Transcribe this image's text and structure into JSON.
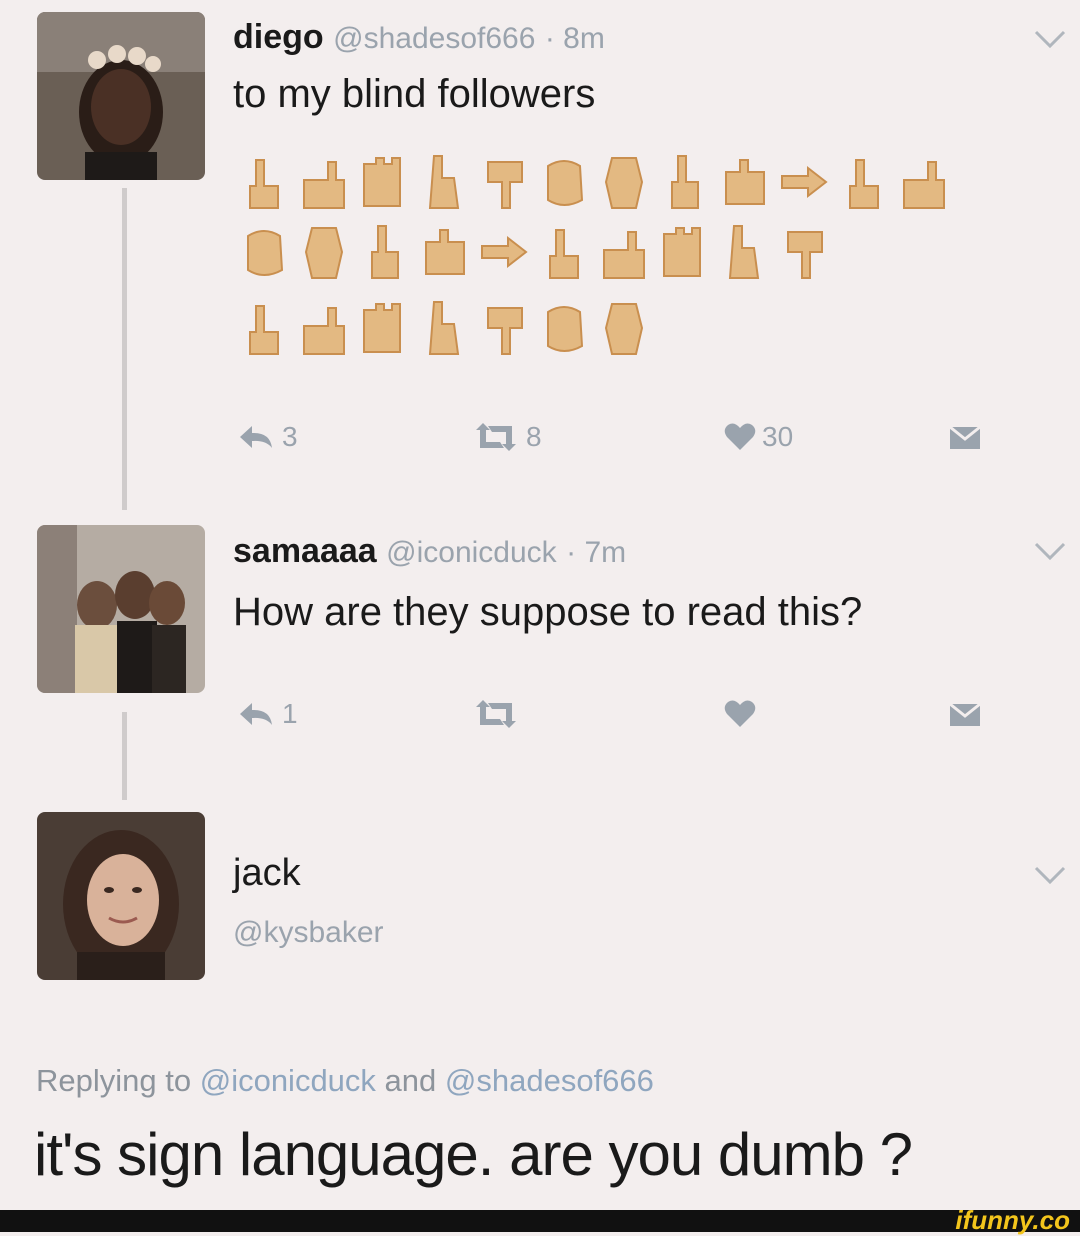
{
  "tweets": [
    {
      "name": "diego",
      "handle": "@shadesof666",
      "time": "· 8m",
      "text": "to my blind followers",
      "reply_count": "3",
      "retweet_count": "8",
      "like_count": "30"
    },
    {
      "name": "samaaaa",
      "handle": "@iconicduck",
      "time": "· 7m",
      "text": "How are they suppose to read this?",
      "reply_count": "1",
      "retweet_count": "",
      "like_count": ""
    },
    {
      "name": "jack",
      "handle": "@kysbaker",
      "replying_prefix": "Replying to ",
      "replying_mention_1": "@iconicduck",
      "replying_and": " and ",
      "replying_mention_2": "@shadesof666",
      "text": "it's sign language. are you dumb ?"
    }
  ],
  "emoji_icons": [
    "hand-gesture-icon"
  ],
  "watermark": "ifunny.co",
  "colors": {
    "background": "#f3eeee",
    "muted": "#9aa3ad",
    "skin": "#e3b982",
    "skin_dark": "#c98f4f"
  }
}
